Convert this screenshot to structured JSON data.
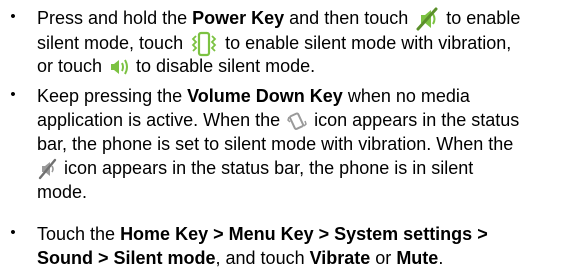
{
  "bullets": [
    {
      "lines": [
        [
          "Press and hold the ",
          {
            "b": "Power Key"
          },
          " and then touch ",
          {
            "icon": "silent-icon"
          },
          " to enable"
        ],
        [
          "silent mode, touch ",
          {
            "icon": "vibrate-icon"
          },
          " to enable silent mode with vibration,"
        ],
        [
          "or touch ",
          {
            "icon": "speaker-icon"
          },
          " to disable silent mode."
        ]
      ]
    },
    {
      "lines": [
        [
          "Keep pressing the ",
          {
            "b": "Volume Down Key"
          },
          " when no media"
        ],
        [
          "application is active. When the ",
          {
            "icon": "vibrate-status-icon"
          },
          " icon appears in the status"
        ],
        [
          "bar, the phone is set to silent mode with vibration. When the"
        ],
        [
          {
            "icon": "silent-status-icon"
          },
          " icon appears in the status bar, the phone is in silent"
        ],
        [
          "mode."
        ]
      ]
    },
    {
      "lines": [
        [
          "Touch the ",
          {
            "b": "Home Key > Menu Key > System settings >"
          }
        ],
        [
          {
            "b": "Sound > Silent mode"
          },
          ", and touch ",
          {
            "b": "Vibrate"
          },
          " or ",
          {
            "b": "Mute"
          },
          "."
        ]
      ]
    }
  ],
  "bullet_symbol": "•",
  "colors": {
    "text": "#000000",
    "icon_green": "#7cc242",
    "icon_gray": "#9a9a9a"
  }
}
